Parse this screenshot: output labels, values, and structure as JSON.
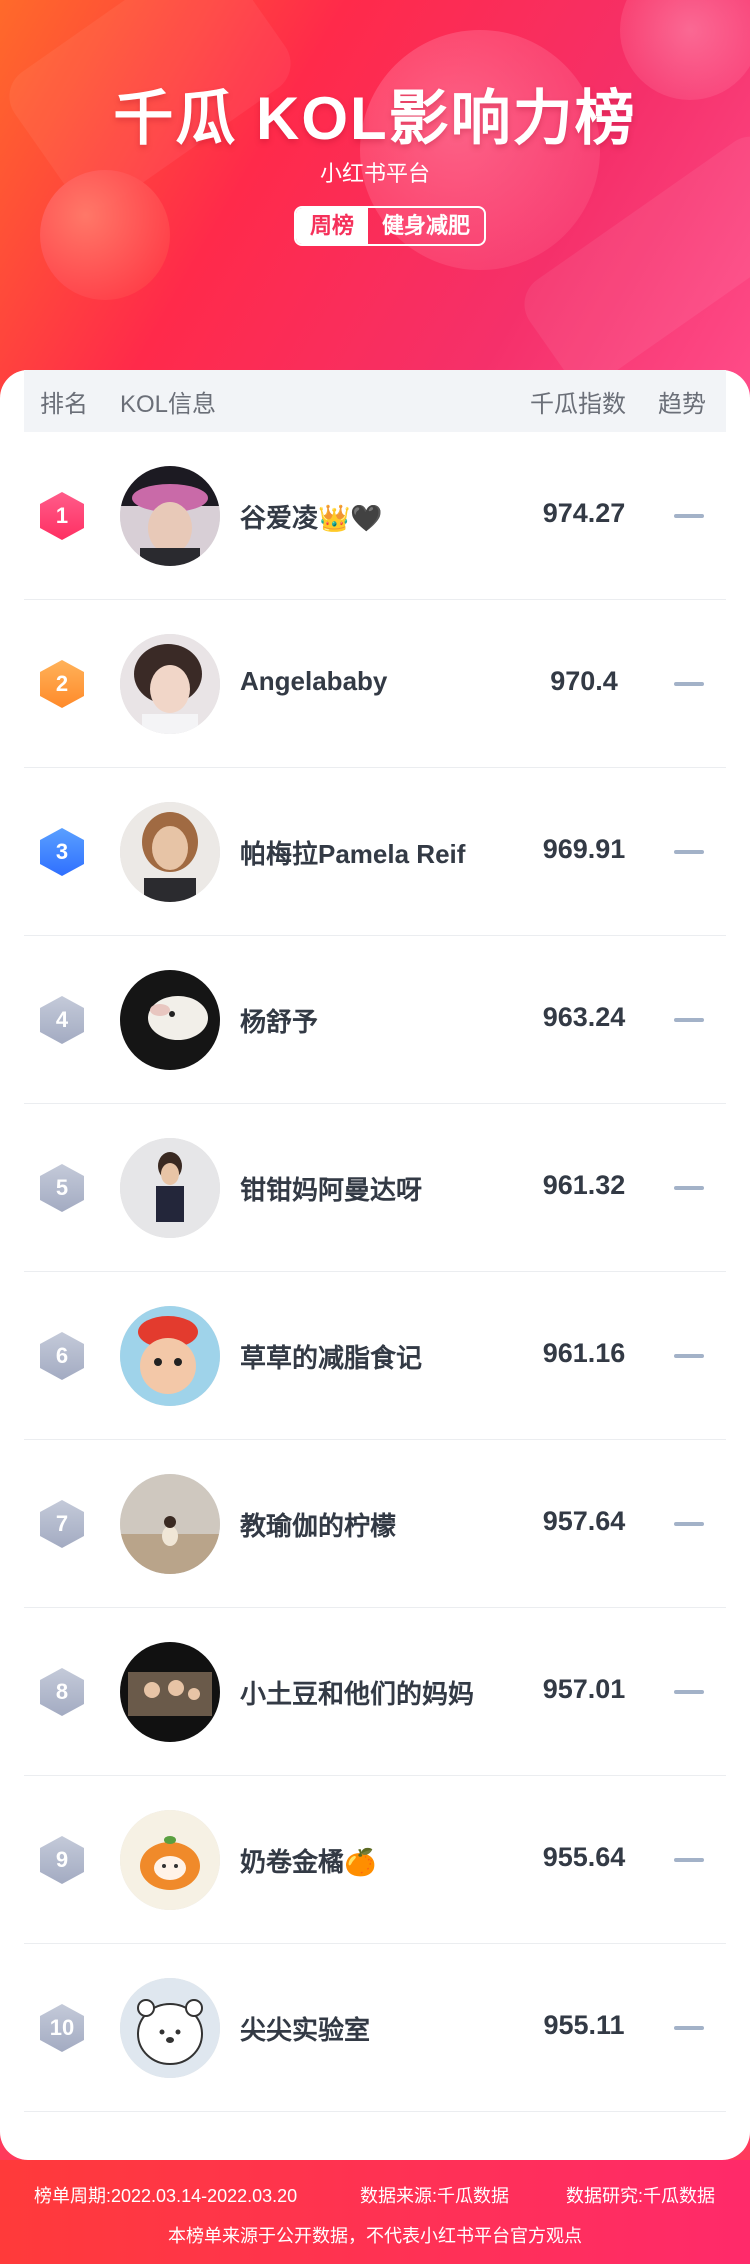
{
  "header": {
    "title": "千瓜 KOL影响力榜",
    "subtitle": "小红书平台",
    "tag_period": "周榜",
    "tag_category": "健身减肥"
  },
  "table": {
    "col_rank": "排名",
    "col_kol": "KOL信息",
    "col_index": "千瓜指数",
    "col_trend": "趋势"
  },
  "rows": [
    {
      "rank": "1",
      "name": "谷爱凌👑🖤",
      "score": "974.27",
      "trend": "flat"
    },
    {
      "rank": "2",
      "name": "Angelababy",
      "score": "970.4",
      "trend": "flat"
    },
    {
      "rank": "3",
      "name": "帕梅拉Pamela Reif",
      "score": "969.91",
      "trend": "flat"
    },
    {
      "rank": "4",
      "name": "杨舒予",
      "score": "963.24",
      "trend": "flat"
    },
    {
      "rank": "5",
      "name": "钳钳妈阿曼达呀",
      "score": "961.32",
      "trend": "flat"
    },
    {
      "rank": "6",
      "name": "草草的减脂食记",
      "score": "961.16",
      "trend": "flat"
    },
    {
      "rank": "7",
      "name": "教瑜伽的柠檬",
      "score": "957.64",
      "trend": "flat"
    },
    {
      "rank": "8",
      "name": "小土豆和他们的妈妈",
      "score": "957.01",
      "trend": "flat"
    },
    {
      "rank": "9",
      "name": "奶卷金橘🍊",
      "score": "955.64",
      "trend": "flat"
    },
    {
      "rank": "10",
      "name": "尖尖实验室",
      "score": "955.11",
      "trend": "flat"
    }
  ],
  "footer": {
    "period": "榜单周期:2022.03.14-2022.03.20",
    "source": "数据来源:千瓜数据",
    "research": "数据研究:千瓜数据",
    "note": "本榜单来源于公开数据，不代表小红书平台官方观点"
  },
  "colors": {
    "brand": "#ff2a4a",
    "rank1": "#ff2f62",
    "rank2": "#ff8a2a",
    "rank3": "#2f6fff",
    "rank_other": "#a3abc2",
    "trend_flat": "#a3b2c8"
  }
}
